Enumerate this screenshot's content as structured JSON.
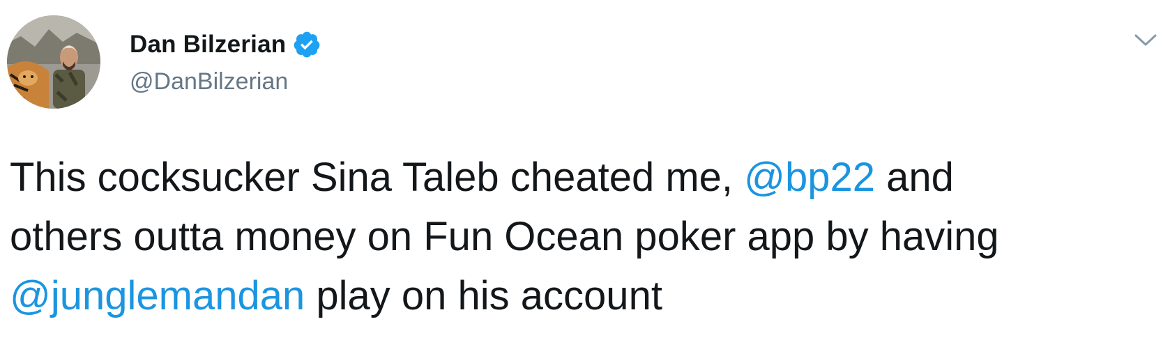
{
  "author": {
    "display_name": "Dan Bilzerian",
    "handle": "@DanBilzerian",
    "verified": true,
    "avatar_icon": "profile-photo"
  },
  "menu": {
    "icon": "chevron-down-icon"
  },
  "tweet": {
    "line1_text": "This cocksucker Sina Taleb cheated me, ",
    "line1_mention": "@bp22",
    "line1_suffix": " and",
    "line2_text": "others outta money on Fun Ocean poker app by having",
    "line3_mention": "@junglemandan",
    "line3_suffix": " play on his account"
  },
  "colors": {
    "link": "#1b95e0",
    "verified_badge": "#1da1f2",
    "secondary_text": "#657786",
    "primary_text": "#14171a"
  }
}
